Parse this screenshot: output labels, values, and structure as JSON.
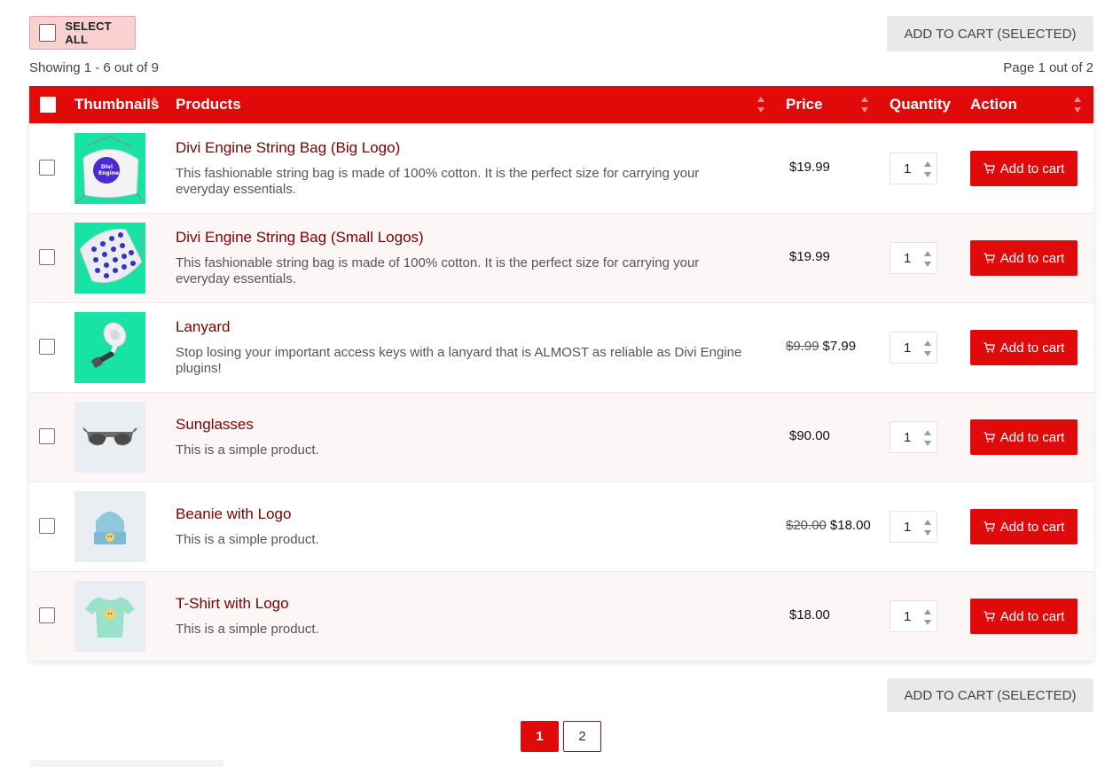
{
  "controls": {
    "select_all_label": "SELECT ALL",
    "add_selected_label": "ADD TO CART (SELECTED)"
  },
  "status": {
    "showing": "Showing 1 - 6 out of 9",
    "page": "Page 1 out of 2"
  },
  "table": {
    "headers": {
      "thumbnails": "Thumbnails",
      "products": "Products",
      "price": "Price",
      "quantity": "Quantity",
      "action": "Action"
    },
    "rows": [
      {
        "name": "Divi Engine String Bag (Big Logo)",
        "desc": "This fashionable string bag is made of 100% cotton. It is the perfect size for carrying your everyday essentials.",
        "old_price": "",
        "price": "$19.99",
        "qty": "1",
        "action": "Add to cart"
      },
      {
        "name": "Divi Engine String Bag (Small Logos)",
        "desc": "This fashionable string bag is made of 100% cotton. It is the perfect size for carrying your everyday essentials.",
        "old_price": "",
        "price": "$19.99",
        "qty": "1",
        "action": "Add to cart"
      },
      {
        "name": "Lanyard",
        "desc": "Stop losing your important access keys with a lanyard that is ALMOST as reliable as Divi Engine plugins!",
        "old_price": "$9.99",
        "price": "$7.99",
        "qty": "1",
        "action": "Add to cart"
      },
      {
        "name": "Sunglasses",
        "desc": "This is a simple product.",
        "old_price": "",
        "price": "$90.00",
        "qty": "1",
        "action": "Add to cart"
      },
      {
        "name": "Beanie with Logo",
        "desc": "This is a simple product.",
        "old_price": "$20.00",
        "price": "$18.00",
        "qty": "1",
        "action": "Add to cart"
      },
      {
        "name": "T-Shirt with Logo",
        "desc": "This is a simple product.",
        "old_price": "",
        "price": "$18.00",
        "qty": "1",
        "action": "Add to cart"
      }
    ]
  },
  "pagination": {
    "pages": [
      "1",
      "2"
    ],
    "current": "1"
  },
  "colors": {
    "accent": "#e00a0a",
    "product_link": "#7b0000",
    "row_alt": "#fcf7f6"
  },
  "thumb_logo_text": [
    "Divi",
    "Engine"
  ]
}
